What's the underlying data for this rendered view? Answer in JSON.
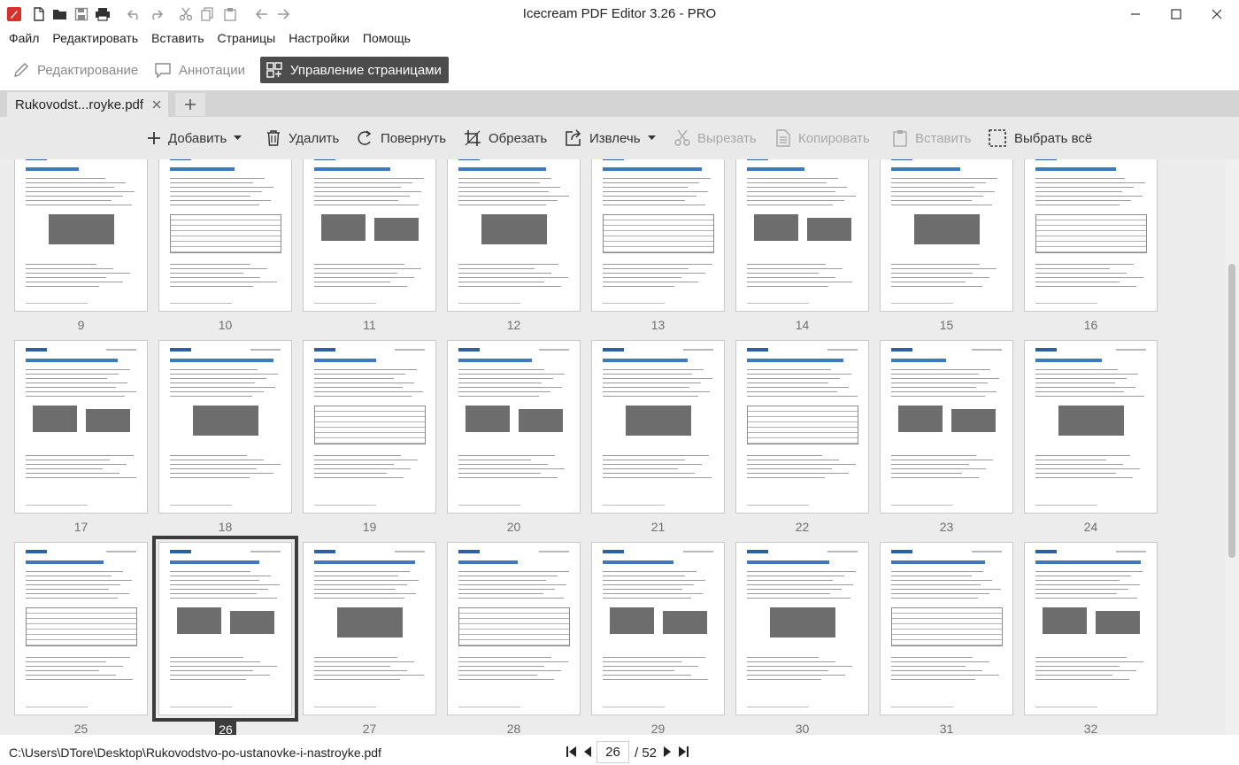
{
  "window": {
    "title": "Icecream PDF Editor 3.26 - PRO"
  },
  "quick_access": [
    "app-logo-icon",
    "new-file-icon",
    "open-folder-icon",
    "save-icon",
    "print-icon",
    "undo-icon",
    "redo-icon",
    "cut-icon",
    "copy-icon",
    "paste-icon",
    "back-icon",
    "forward-icon"
  ],
  "menu": [
    "Файл",
    "Редактировать",
    "Вставить",
    "Страницы",
    "Настройки",
    "Помощь"
  ],
  "modes": {
    "edit": "Редактирование",
    "annotate": "Аннотации",
    "pages": "Управление страницами",
    "active": "pages"
  },
  "tab": {
    "label": "Rukovodst...royke.pdf"
  },
  "toolbar": {
    "add": "Добавить",
    "delete": "Удалить",
    "rotate": "Повернуть",
    "crop": "Обрезать",
    "extract": "Извлечь",
    "cut": "Вырезать",
    "copy": "Копировать",
    "paste": "Вставить",
    "select_all": "Выбрать всё"
  },
  "pages": {
    "rows": [
      [
        "9",
        "10",
        "11",
        "12",
        "13",
        "14",
        "15",
        "16"
      ],
      [
        "17",
        "18",
        "19",
        "20",
        "21",
        "22",
        "23",
        "24"
      ],
      [
        "25",
        "26",
        "27",
        "28",
        "29",
        "30",
        "31",
        "32"
      ]
    ],
    "selected": "26"
  },
  "status": {
    "path": "C:\\Users\\DTore\\Desktop\\Rukovodstvo-po-ustanovke-i-nastroyke.pdf",
    "current_page": "26",
    "total_pages": "/ 52"
  },
  "colors": {
    "accent_dark": "#3c3c3c",
    "doc_blue": "#2d5fa3",
    "toolbar_bg": "#e9e9e9"
  }
}
